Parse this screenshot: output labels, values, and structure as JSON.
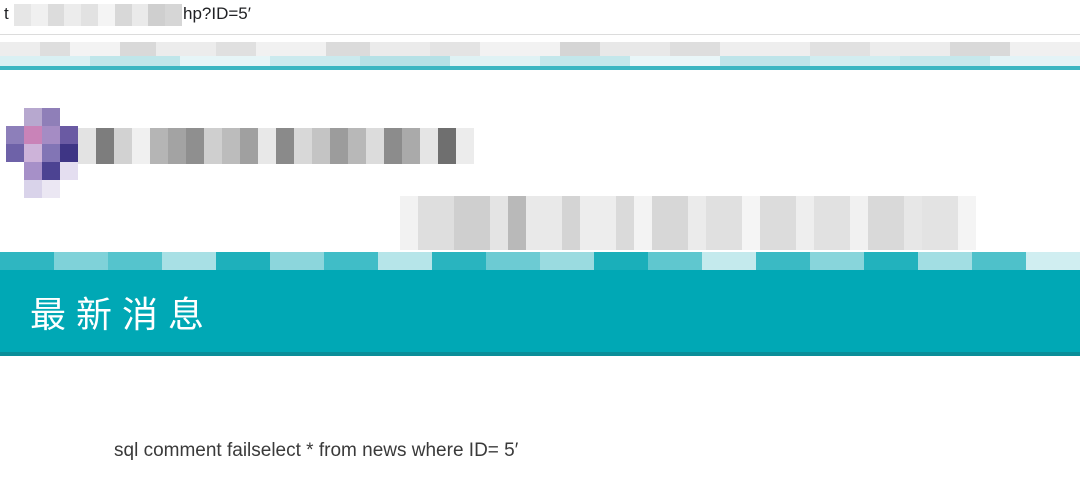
{
  "url_bar": {
    "prefix": "t",
    "suffix": "hp?ID=5′"
  },
  "banner": {
    "title": "最新消息",
    "color": "#00a8b5"
  },
  "content": {
    "error_message": "sql comment failselect * from news where ID= 5′"
  },
  "colors": {
    "accent": "#00a8b5",
    "nav_line": "#3bb6c2",
    "text": "#3a3a3a"
  }
}
